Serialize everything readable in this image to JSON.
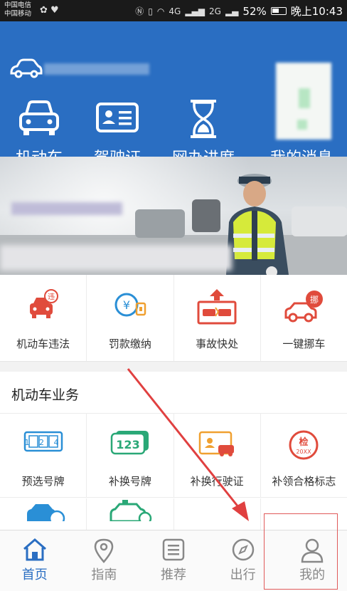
{
  "status_bar": {
    "carrier1": "中国电信",
    "carrier2": "中国移动",
    "network": "4G",
    "network2": "2G",
    "battery": "52%",
    "time": "晚上10:43"
  },
  "header": {
    "nav": [
      {
        "label": "机动车",
        "icon": "car-icon"
      },
      {
        "label": "驾驶证",
        "icon": "license-card-icon"
      },
      {
        "label": "网办进度",
        "icon": "hourglass-icon"
      },
      {
        "label": "我的消息",
        "icon": "message-icon"
      }
    ]
  },
  "quick": [
    {
      "label": "机动车违法",
      "badge": "违"
    },
    {
      "label": "罚款缴纳",
      "badge": "¥"
    },
    {
      "label": "事故快处",
      "badge": ""
    },
    {
      "label": "一键挪车",
      "badge": "挪"
    }
  ],
  "section": {
    "title": "机动车业务",
    "items": [
      {
        "label": "预选号牌",
        "plate": "1 2 4"
      },
      {
        "label": "补换号牌",
        "plate": "123"
      },
      {
        "label": "补换行驶证",
        "plate": ""
      },
      {
        "label": "补领合格标志",
        "badge_top": "检",
        "badge_bottom": "20XX"
      }
    ]
  },
  "bottom_nav": [
    {
      "label": "首页",
      "icon": "home-icon",
      "active": true
    },
    {
      "label": "指南",
      "icon": "location-pin-icon",
      "active": false
    },
    {
      "label": "推荐",
      "icon": "document-list-icon",
      "active": false
    },
    {
      "label": "出行",
      "icon": "compass-icon",
      "active": false
    },
    {
      "label": "我的",
      "icon": "user-icon",
      "active": false
    }
  ],
  "colors": {
    "primary_blue": "#2a6ec2",
    "accent_red": "#e04b3c",
    "accent_green": "#2aa877",
    "accent_orange": "#f0a030"
  }
}
